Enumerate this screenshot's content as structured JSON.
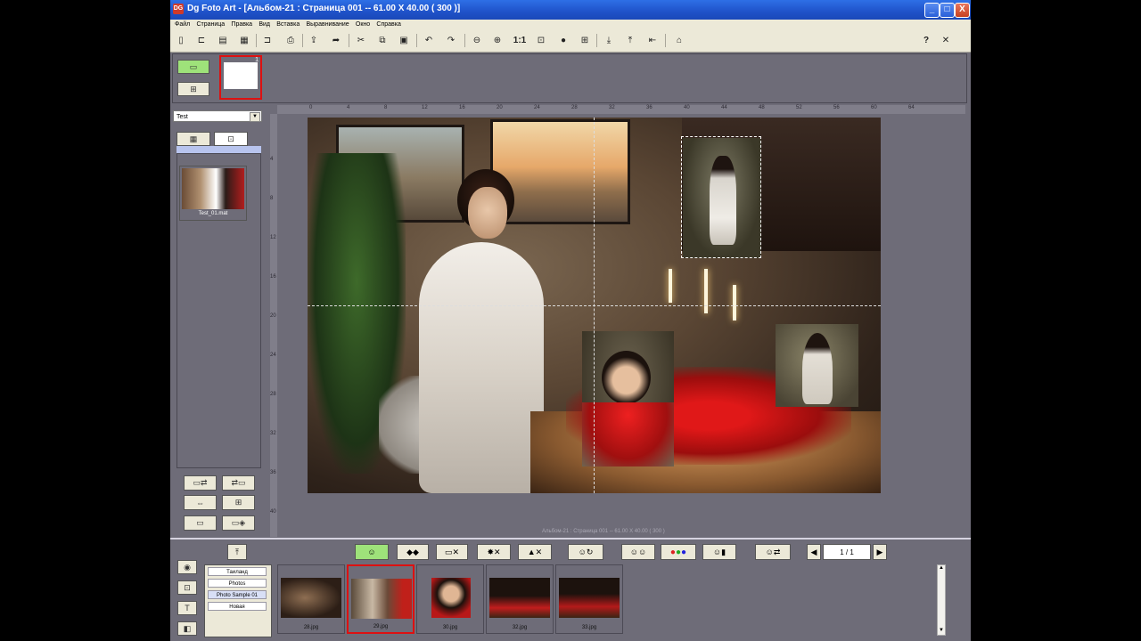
{
  "window": {
    "title": "Dg Foto Art - [Альбом-21 : Страница 001 -- 61.00 X 40.00 ( 300 )]",
    "app_icon": "DG",
    "controls": {
      "minimize": "_",
      "maximize": "□",
      "close": "X"
    }
  },
  "menu": {
    "items": [
      "Файл",
      "Страница",
      "Правка",
      "Вид",
      "Вставка",
      "Выравнивание",
      "Окно",
      "Справка"
    ]
  },
  "toolbar": {
    "zoom_actual": "1:1",
    "help": "?"
  },
  "page_strip": {
    "page_number": "1"
  },
  "left_panel": {
    "folder_select": "Test",
    "file_thumb_label": "Test_01.mat"
  },
  "ruler": {
    "h_ticks": [
      "0",
      "4",
      "8",
      "12",
      "16",
      "20",
      "24",
      "28",
      "32",
      "36",
      "40",
      "44",
      "48",
      "52",
      "56",
      "60",
      "64"
    ],
    "v_ticks": [
      "4",
      "8",
      "12",
      "16",
      "20",
      "24",
      "28",
      "32",
      "36",
      "40"
    ]
  },
  "canvas": {
    "caption": "Альбом-21 : Страница 001 -- 61.00 X 40.00 ( 300 )"
  },
  "pagination": {
    "current": "1 / 1",
    "prev": "◀",
    "next": "▶"
  },
  "categories": [
    "Таиланд",
    "Photos",
    "Photo Sample 01",
    "Новая"
  ],
  "thumbnails": [
    {
      "label": "28.jpg"
    },
    {
      "label": "29.jpg"
    },
    {
      "label": "30.jpg"
    },
    {
      "label": "32.jpg"
    },
    {
      "label": "33.jpg"
    }
  ],
  "colors": {
    "titlebar": "#1f52c9",
    "workspace": "#6e6c78",
    "chrome": "#ece9d8",
    "selection_red": "#dd1111",
    "green_button": "#9ee27a"
  }
}
